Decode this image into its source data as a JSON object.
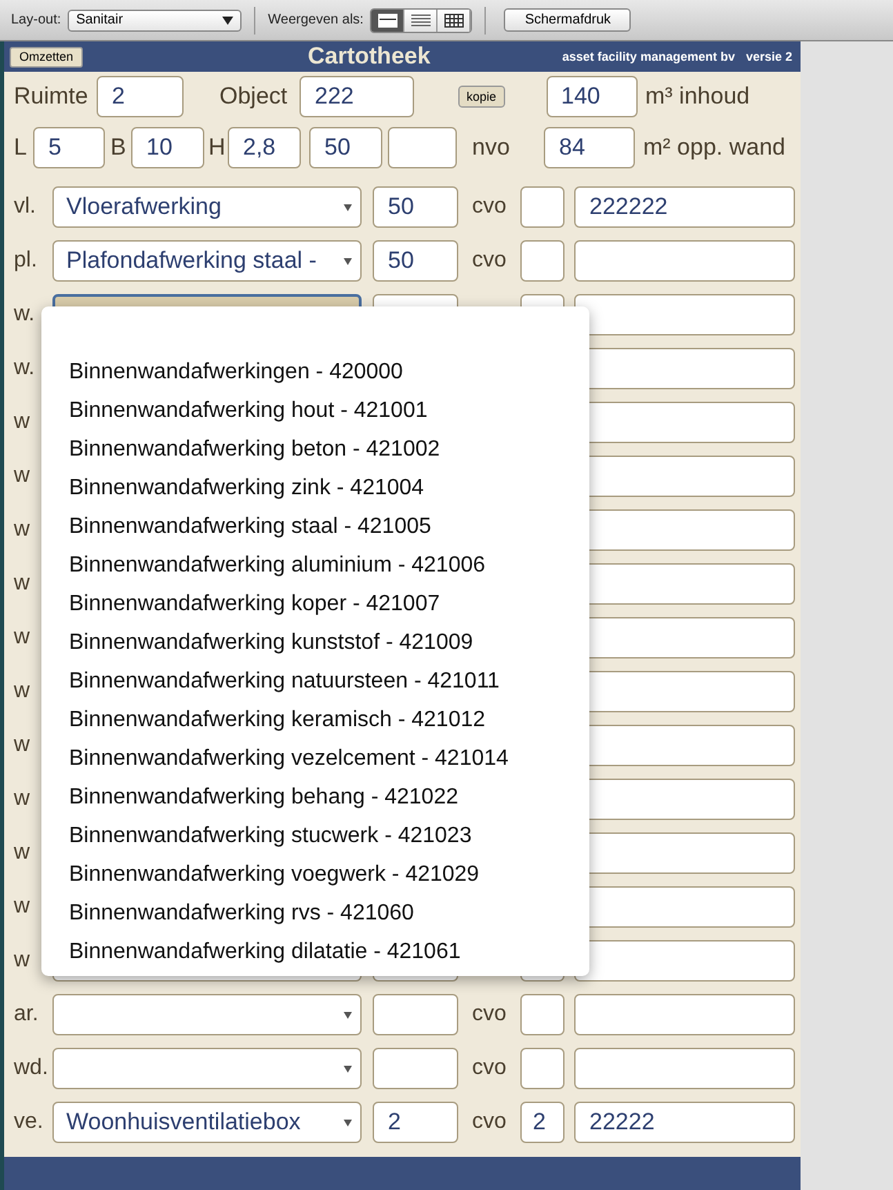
{
  "toolbar": {
    "layout_label": "Lay-out:",
    "layout_select": "Sanitair",
    "view_label": "Weergeven als:",
    "view_modes": [
      {
        "kind": "form",
        "selected": true
      },
      {
        "kind": "list",
        "selected": false
      },
      {
        "kind": "table",
        "selected": false
      }
    ],
    "print_button": "Schermafdruk"
  },
  "header": {
    "button": "Omzetten",
    "title": "Cartotheek",
    "company": "asset facility management bv",
    "version": "versie 2"
  },
  "room": {
    "ruimte_label": "Ruimte",
    "ruimte": "2",
    "object_label": "Object",
    "object": "222",
    "copy_button": "kopie",
    "volume": "140",
    "volume_label": "m³ inhoud"
  },
  "dimensions": {
    "l_label": "L",
    "l": "5",
    "b_label": "B",
    "b": "10",
    "h_label": "H",
    "h": "2,8",
    "field_4": "50",
    "nvo_label": "nvo",
    "area": "84",
    "area_label": "m² opp. wand"
  },
  "rows": [
    {
      "label": "vl.",
      "select": "Vloerafwerking",
      "number": "50",
      "cvo_label": "cvo",
      "cvo": "",
      "code": "222222",
      "focused": false
    },
    {
      "label": "pl.",
      "select": "Plafondafwerking staal -",
      "number": "50",
      "cvo_label": "cvo",
      "cvo": "",
      "code": "",
      "focused": false
    },
    {
      "label": "w.",
      "focused": true
    },
    {
      "label": "w."
    },
    {
      "label": "w"
    },
    {
      "label": "w"
    },
    {
      "label": "w"
    },
    {
      "label": "w"
    },
    {
      "label": "w"
    },
    {
      "label": "w"
    },
    {
      "label": "w"
    },
    {
      "label": "w"
    },
    {
      "label": "w"
    },
    {
      "label": "w"
    },
    {
      "label": "w"
    },
    {
      "label": "ar.",
      "select": "",
      "number": "",
      "cvo_label": "cvo",
      "cvo": "",
      "code": "",
      "focused": false
    },
    {
      "label": "wd.",
      "select": "",
      "number": "",
      "cvo_label": "cvo",
      "cvo": "",
      "code": "",
      "focused": false
    },
    {
      "label": "ve.",
      "select": "Woonhuisventilatiebox",
      "number": "2",
      "cvo_label": "cvo",
      "cvo": "2",
      "code": "22222",
      "focused": false
    }
  ],
  "dropdown": {
    "options": [
      "Binnenwandafwerkingen - 420000",
      "Binnenwandafwerking hout - 421001",
      "Binnenwandafwerking beton - 421002",
      "Binnenwandafwerking zink - 421004",
      "Binnenwandafwerking staal - 421005",
      "Binnenwandafwerking aluminium - 421006",
      "Binnenwandafwerking koper - 421007",
      "Binnenwandafwerking kunststof - 421009",
      "Binnenwandafwerking natuursteen - 421011",
      "Binnenwandafwerking keramisch - 421012",
      "Binnenwandafwerking vezelcement - 421014",
      "Binnenwandafwerking behang - 421022",
      "Binnenwandafwerking stucwerk - 421023",
      "Binnenwandafwerking voegwerk - 421029",
      "Binnenwandafwerking rvs - 421060",
      "Binnenwandafwerking dilatatie - 421061"
    ]
  }
}
